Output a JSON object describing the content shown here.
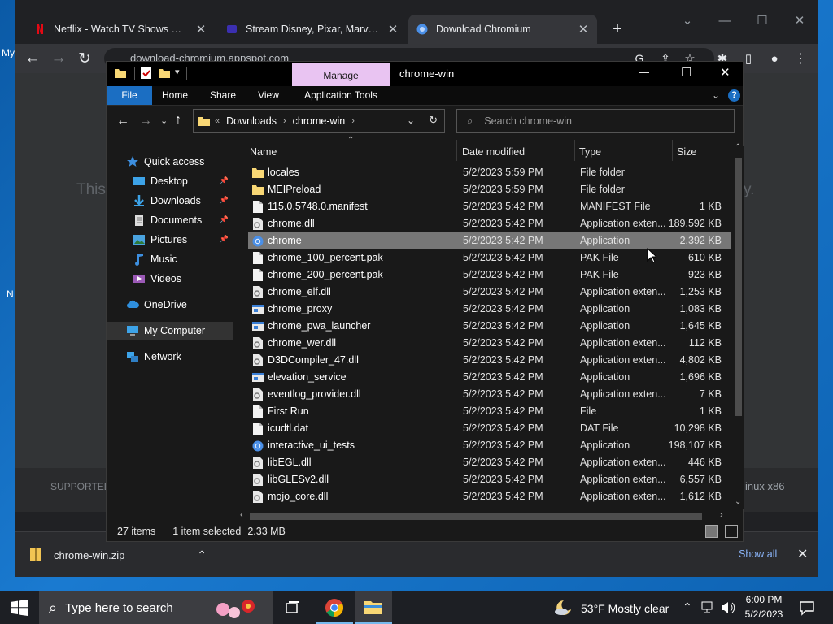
{
  "desktop": {
    "left_label_1": "My",
    "left_label_2": "N"
  },
  "browser": {
    "tabs": [
      {
        "label": "Netflix - Watch TV Shows Online, W",
        "active": false
      },
      {
        "label": "Stream Disney, Pixar, Marvel, Star",
        "active": false
      },
      {
        "label": "Download Chromium",
        "active": true
      }
    ],
    "new_tab": "+",
    "url": "download-chromium.appspot.com",
    "page_faint_left": "This",
    "page_faint_right": "y.",
    "page_supported": "SUPPORTED",
    "page_os": "inux x86"
  },
  "download_bar": {
    "file": "chrome-win.zip",
    "show_all": "Show all"
  },
  "explorer": {
    "title": "chrome-win",
    "context_tab": "Manage",
    "ribbon_tabs": [
      "File",
      "Home",
      "Share",
      "View",
      "Application Tools"
    ],
    "breadcrumb": [
      "Downloads",
      "chrome-win"
    ],
    "search_placeholder": "Search chrome-win",
    "nav": [
      {
        "label": "Quick access",
        "icon": "star-icon",
        "pinned": false
      },
      {
        "label": "Desktop",
        "icon": "desktop-icon",
        "pinned": true
      },
      {
        "label": "Downloads",
        "icon": "download-icon",
        "pinned": true
      },
      {
        "label": "Documents",
        "icon": "document-icon",
        "pinned": true
      },
      {
        "label": "Pictures",
        "icon": "picture-icon",
        "pinned": true
      },
      {
        "label": "Music",
        "icon": "music-icon",
        "pinned": false
      },
      {
        "label": "Videos",
        "icon": "video-icon",
        "pinned": false
      },
      {
        "label": "OneDrive",
        "icon": "cloud-icon",
        "pinned": false
      },
      {
        "label": "My Computer",
        "icon": "computer-icon",
        "pinned": false,
        "selected": true
      },
      {
        "label": "Network",
        "icon": "network-icon",
        "pinned": false
      }
    ],
    "columns": [
      "Name",
      "Date modified",
      "Type",
      "Size"
    ],
    "files": [
      {
        "name": "locales",
        "date": "5/2/2023 5:59 PM",
        "type": "File folder",
        "size": "",
        "icon": "folder-icon"
      },
      {
        "name": "MEIPreload",
        "date": "5/2/2023 5:59 PM",
        "type": "File folder",
        "size": "",
        "icon": "folder-icon"
      },
      {
        "name": "115.0.5748.0.manifest",
        "date": "5/2/2023 5:42 PM",
        "type": "MANIFEST File",
        "size": "1 KB",
        "icon": "file-icon"
      },
      {
        "name": "chrome.dll",
        "date": "5/2/2023 5:42 PM",
        "type": "Application exten...",
        "size": "189,592 KB",
        "icon": "dll-icon"
      },
      {
        "name": "chrome",
        "date": "5/2/2023 5:42 PM",
        "type": "Application",
        "size": "2,392 KB",
        "icon": "chromium-icon",
        "selected": true
      },
      {
        "name": "chrome_100_percent.pak",
        "date": "5/2/2023 5:42 PM",
        "type": "PAK File",
        "size": "610 KB",
        "icon": "file-icon"
      },
      {
        "name": "chrome_200_percent.pak",
        "date": "5/2/2023 5:42 PM",
        "type": "PAK File",
        "size": "923 KB",
        "icon": "file-icon"
      },
      {
        "name": "chrome_elf.dll",
        "date": "5/2/2023 5:42 PM",
        "type": "Application exten...",
        "size": "1,253 KB",
        "icon": "dll-icon"
      },
      {
        "name": "chrome_proxy",
        "date": "5/2/2023 5:42 PM",
        "type": "Application",
        "size": "1,083 KB",
        "icon": "exe-icon"
      },
      {
        "name": "chrome_pwa_launcher",
        "date": "5/2/2023 5:42 PM",
        "type": "Application",
        "size": "1,645 KB",
        "icon": "exe-icon"
      },
      {
        "name": "chrome_wer.dll",
        "date": "5/2/2023 5:42 PM",
        "type": "Application exten...",
        "size": "112 KB",
        "icon": "dll-icon"
      },
      {
        "name": "D3DCompiler_47.dll",
        "date": "5/2/2023 5:42 PM",
        "type": "Application exten...",
        "size": "4,802 KB",
        "icon": "dll-icon"
      },
      {
        "name": "elevation_service",
        "date": "5/2/2023 5:42 PM",
        "type": "Application",
        "size": "1,696 KB",
        "icon": "exe-icon"
      },
      {
        "name": "eventlog_provider.dll",
        "date": "5/2/2023 5:42 PM",
        "type": "Application exten...",
        "size": "7 KB",
        "icon": "dll-icon"
      },
      {
        "name": "First Run",
        "date": "5/2/2023 5:42 PM",
        "type": "File",
        "size": "1 KB",
        "icon": "file-icon"
      },
      {
        "name": "icudtl.dat",
        "date": "5/2/2023 5:42 PM",
        "type": "DAT File",
        "size": "10,298 KB",
        "icon": "file-icon"
      },
      {
        "name": "interactive_ui_tests",
        "date": "5/2/2023 5:42 PM",
        "type": "Application",
        "size": "198,107 KB",
        "icon": "chromium-icon"
      },
      {
        "name": "libEGL.dll",
        "date": "5/2/2023 5:42 PM",
        "type": "Application exten...",
        "size": "446 KB",
        "icon": "dll-icon"
      },
      {
        "name": "libGLESv2.dll",
        "date": "5/2/2023 5:42 PM",
        "type": "Application exten...",
        "size": "6,557 KB",
        "icon": "dll-icon"
      },
      {
        "name": "mojo_core.dll",
        "date": "5/2/2023 5:42 PM",
        "type": "Application exten...",
        "size": "1,612 KB",
        "icon": "dll-icon"
      }
    ],
    "status": {
      "count": "27 items",
      "selection": "1 item selected",
      "size": "2.33 MB"
    }
  },
  "taskbar": {
    "search_placeholder": "Type here to search",
    "weather": "53°F  Mostly clear",
    "time": "6:00 PM",
    "date": "5/2/2023"
  },
  "colors": {
    "accent": "#0078d7",
    "manage": "#e9c4f2",
    "selected_row": "#777777"
  }
}
